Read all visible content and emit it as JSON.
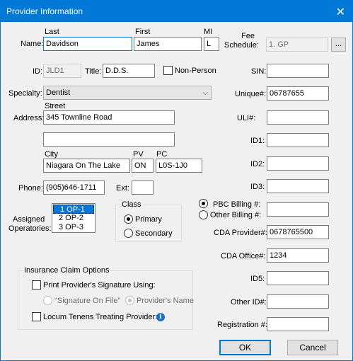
{
  "window": {
    "title": "Provider Information",
    "close_glyph": "✕"
  },
  "name": {
    "label": "Name:",
    "last_header": "Last",
    "first_header": "First",
    "mi_header": "MI",
    "last": "Davidson",
    "first": "James",
    "mi": "L"
  },
  "fee_schedule": {
    "label_line1": "Fee",
    "label_line2": "Schedule:",
    "value": "1.  GP",
    "browse": "..."
  },
  "id": {
    "label": "ID:",
    "value": "JLD1"
  },
  "title_field": {
    "label": "Title:",
    "value": "D.D.S."
  },
  "non_person": {
    "label": "Non-Person",
    "checked": false
  },
  "sin": {
    "label": "SIN:",
    "value": ""
  },
  "specialty": {
    "label": "Specialty:",
    "value": "Dentist"
  },
  "unique": {
    "label": "Unique#:",
    "value": "06787655"
  },
  "address": {
    "label": "Address:",
    "street_header": "Street",
    "line1": "345 Townline Road",
    "line2": "",
    "city_header": "City",
    "pv_header": "PV",
    "pc_header": "PC",
    "city": "Niagara On The Lake",
    "pv": "ON",
    "pc": "L0S-1J0"
  },
  "uli": {
    "label": "ULI#:",
    "value": ""
  },
  "id1": {
    "label": "ID1:",
    "value": ""
  },
  "id2": {
    "label": "ID2:",
    "value": ""
  },
  "id3": {
    "label": "ID3:",
    "value": ""
  },
  "phone": {
    "label": "Phone:",
    "value": "(905)646-1711",
    "ext_label": "Ext:",
    "ext": ""
  },
  "operatories": {
    "label_line1": "Assigned",
    "label_line2": "Operatories:",
    "items": [
      "1  OP-1",
      "2  OP-2",
      "3  OP-3"
    ],
    "selected": "1  OP-1"
  },
  "class": {
    "title": "Class",
    "primary": "Primary",
    "secondary": "Secondary",
    "selected": "Primary"
  },
  "billing": {
    "pbc": "PBC Billing #:",
    "other": "Other Billing #:",
    "selected": "PBC Billing #:",
    "value": ""
  },
  "cda_provider": {
    "label": "CDA Provider#:",
    "value": "0678765500"
  },
  "cda_office": {
    "label": "CDA Office#:",
    "value": "1234"
  },
  "id5": {
    "label": "ID5:",
    "value": ""
  },
  "other_id": {
    "label": "Other ID#:",
    "value": ""
  },
  "registration": {
    "label": "Registration #:",
    "value": ""
  },
  "insurance": {
    "title": "Insurance Claim Options",
    "print_signature": "Print Provider's Signature Using:",
    "sig_on_file": "\"Signature On File\"",
    "providers_name": "Provider's Name",
    "locum": "Locum Tenens Treating Provider:",
    "info_glyph": "i"
  },
  "buttons": {
    "ok": "OK",
    "cancel": "Cancel"
  },
  "colors": {
    "accent": "#0078d7",
    "titlebar_text": "#ffffff",
    "dialog_bg": "#f0f0f0"
  }
}
